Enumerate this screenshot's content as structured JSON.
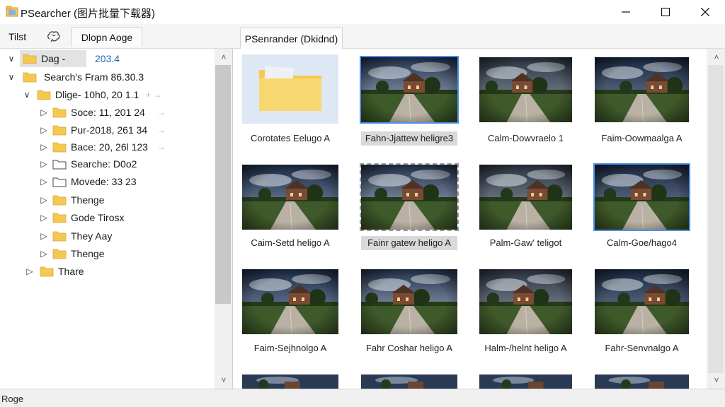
{
  "window": {
    "title": "PSearcher (图片批量下载器)",
    "controls": {
      "minimize": "minimize-icon",
      "maximize": "maximize-icon",
      "close": "close-icon"
    }
  },
  "toolbar": {
    "tilst_label": "Tilst",
    "tab1_label": "Dlopn Aoge",
    "tab2_label": "PSenrander (Dkidnd)"
  },
  "tree": {
    "items": [
      {
        "label": "Dag -",
        "extra": "203.4",
        "expanded": true
      },
      {
        "label": "Search's Fram 86.30.3",
        "expanded": true
      },
      {
        "label": "Dlige- 10h0, 20 1.1",
        "expanded": true
      },
      {
        "label": "Soce: 11, 201 24"
      },
      {
        "label": "Pur-2018, 261 34"
      },
      {
        "label": "Bace: 20, 26l 123"
      },
      {
        "label": "Searche: D0o2"
      },
      {
        "label": "Movede: 33 23"
      },
      {
        "label": "Thenge"
      },
      {
        "label": "Gode Tirosx"
      },
      {
        "label": "They Aay"
      },
      {
        "label": "Thenge"
      },
      {
        "label": "Thare"
      }
    ]
  },
  "grid": {
    "items": [
      {
        "caption": "Corotates Eelugo A",
        "kind": "folder"
      },
      {
        "caption": "Fahn-Jjattew heligre3",
        "kind": "photo",
        "selected": "solid",
        "highlight": true
      },
      {
        "caption": "Calm-Dowvraelo 1",
        "kind": "photo"
      },
      {
        "caption": "Faim-Oowmaalga A",
        "kind": "photo"
      },
      {
        "caption": "Caim-Setd heligo A",
        "kind": "photo"
      },
      {
        "caption": "Fainr gatew heligo A",
        "kind": "photo",
        "selected": "dashed",
        "highlight": true
      },
      {
        "caption": "Palm-Gaw' teligot",
        "kind": "photo"
      },
      {
        "caption": "Calm-Goe/hago4",
        "kind": "photo",
        "selected": "solid"
      },
      {
        "caption": "Faim-Sejhnolgo A",
        "kind": "photo"
      },
      {
        "caption": "Fahr Coshar heligo A",
        "kind": "photo"
      },
      {
        "caption": "Halm-/helnt heligo A",
        "kind": "photo"
      },
      {
        "caption": "Fahr-Senvnalgo A",
        "kind": "photo"
      }
    ]
  },
  "status": {
    "text": "Roge"
  },
  "colors": {
    "accent": "#4d90e6",
    "folder": "#f5c851",
    "selection": "#e3e3e3"
  }
}
